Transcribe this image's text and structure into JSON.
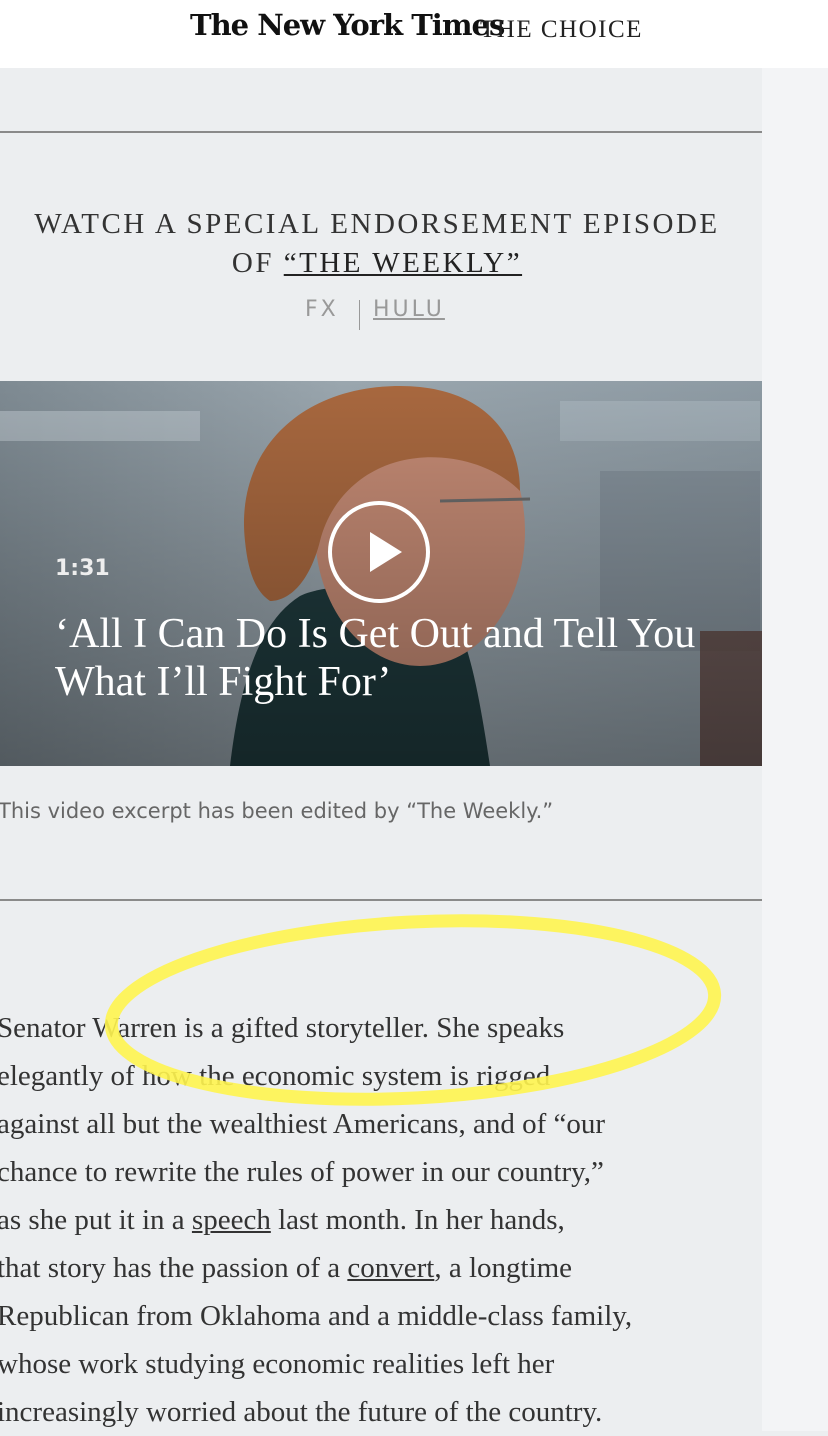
{
  "header": {
    "logo": "The New York Times",
    "section": "THE CHOICE"
  },
  "promo": {
    "heading_line1": "WATCH A SPECIAL ENDORSEMENT EPISODE",
    "heading_of": "OF ",
    "heading_link": "“THE WEEKLY”",
    "fx": "FX",
    "hulu": "HULU"
  },
  "video": {
    "duration": "1:31",
    "title": "‘All I Can Do Is Get Out and Tell You What I’ll Fight For’",
    "caption": "This video excerpt has been edited by “The Weekly.”"
  },
  "article": {
    "line1": "Senator Warren is a gifted storyteller. She speaks",
    "line2": "elegantly of how the economic system is rigged",
    "line3": "against all but the wealthiest Americans, and of “our",
    "line4": "chance to rewrite the rules of power in our country,”",
    "line5_pre": "as she put it in a ",
    "line5_link": "speech",
    "line5_post": " last month. In her hands,",
    "line6_pre": "that story has the passion of a ",
    "line6_link": "convert",
    "line6_post": ", a longtime",
    "line7": "Republican from Oklahoma and a middle-class family,",
    "line8": "whose work studying economic realities left her",
    "line9": "increasingly worried about the future of the country."
  },
  "colors": {
    "background": "#eceef0",
    "highlight": "#fff44f"
  }
}
